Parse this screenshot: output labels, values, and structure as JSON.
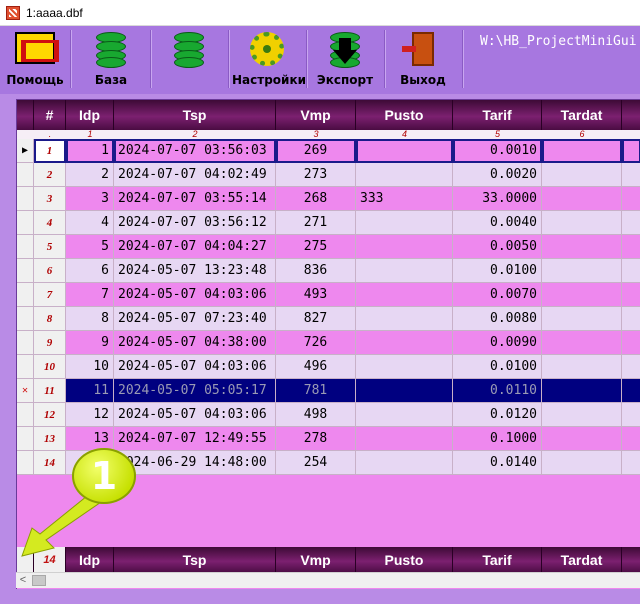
{
  "window": {
    "title": "1:aaaa.dbf"
  },
  "toolbar": {
    "buttons": [
      {
        "label": "Помощь",
        "icon": "help-icon"
      },
      {
        "label": "База",
        "icon": "database-icon"
      },
      {
        "label": "",
        "icon": "database-key-icon"
      },
      {
        "label": "Настройки",
        "icon": "settings-gear-icon"
      },
      {
        "label": "Экспорт",
        "icon": "export-icon"
      },
      {
        "label": "Выход",
        "icon": "exit-door-icon"
      }
    ],
    "path": "W:\\HB_ProjectMiniGui"
  },
  "grid": {
    "columns": [
      {
        "label": "#",
        "num": "."
      },
      {
        "label": "Idp",
        "num": "1"
      },
      {
        "label": "Tsp",
        "num": "2"
      },
      {
        "label": "Vmp",
        "num": "3"
      },
      {
        "label": "Pusto",
        "num": "4"
      },
      {
        "label": "Tarif",
        "num": "5"
      },
      {
        "label": "Tardat",
        "num": "6"
      }
    ],
    "rows": [
      {
        "rn": "1",
        "idp": "1",
        "tsp": "2024-07-07 03:56:03",
        "vmp": "269",
        "pusto": "",
        "tarif": "0.0010",
        "tardat": ""
      },
      {
        "rn": "2",
        "idp": "2",
        "tsp": "2024-07-07 04:02:49",
        "vmp": "273",
        "pusto": "",
        "tarif": "0.0020",
        "tardat": ""
      },
      {
        "rn": "3",
        "idp": "3",
        "tsp": "2024-07-07 03:55:14",
        "vmp": "268",
        "pusto": "333",
        "tarif": "33.0000",
        "tardat": ""
      },
      {
        "rn": "4",
        "idp": "4",
        "tsp": "2024-07-07 03:56:12",
        "vmp": "271",
        "pusto": "",
        "tarif": "0.0040",
        "tardat": ""
      },
      {
        "rn": "5",
        "idp": "5",
        "tsp": "2024-07-07 04:04:27",
        "vmp": "275",
        "pusto": "",
        "tarif": "0.0050",
        "tardat": ""
      },
      {
        "rn": "6",
        "idp": "6",
        "tsp": "2024-05-07 13:23:48",
        "vmp": "836",
        "pusto": "",
        "tarif": "0.0100",
        "tardat": ""
      },
      {
        "rn": "7",
        "idp": "7",
        "tsp": "2024-05-07 04:03:06",
        "vmp": "493",
        "pusto": "",
        "tarif": "0.0070",
        "tardat": ""
      },
      {
        "rn": "8",
        "idp": "8",
        "tsp": "2024-05-07 07:23:40",
        "vmp": "827",
        "pusto": "",
        "tarif": "0.0080",
        "tardat": ""
      },
      {
        "rn": "9",
        "idp": "9",
        "tsp": "2024-05-07 04:38:00",
        "vmp": "726",
        "pusto": "",
        "tarif": "0.0090",
        "tardat": ""
      },
      {
        "rn": "10",
        "idp": "10",
        "tsp": "2024-05-07 04:03:06",
        "vmp": "496",
        "pusto": "",
        "tarif": "0.0100",
        "tardat": ""
      },
      {
        "rn": "11",
        "idp": "11",
        "tsp": "2024-05-07 05:05:17",
        "vmp": "781",
        "pusto": "",
        "tarif": "0.0110",
        "tardat": ""
      },
      {
        "rn": "12",
        "idp": "12",
        "tsp": "2024-05-07 04:03:06",
        "vmp": "498",
        "pusto": "",
        "tarif": "0.0120",
        "tardat": ""
      },
      {
        "rn": "13",
        "idp": "13",
        "tsp": "2024-07-07 12:49:55",
        "vmp": "278",
        "pusto": "",
        "tarif": "0.1000",
        "tardat": ""
      },
      {
        "rn": "14",
        "idp": "",
        "tsp": "2024-06-29 14:48:00",
        "vmp": "254",
        "pusto": "",
        "tarif": "0.0140",
        "tardat": ""
      }
    ],
    "current_row_marker": "▶",
    "deleted_marker": "✕",
    "footer": {
      "count": "14",
      "labels": [
        "Idp",
        "Tsp",
        "Vmp",
        "Pusto",
        "Tarif",
        "Tardat"
      ]
    }
  },
  "callout": {
    "text": "1"
  },
  "scrollbar": {
    "left_arrow": "<"
  },
  "colors": {
    "header": "#7c2070",
    "row_odd": "#ee88ee",
    "row_even": "#e7d7f3",
    "selected": "#000080",
    "background": "#b98be6"
  }
}
